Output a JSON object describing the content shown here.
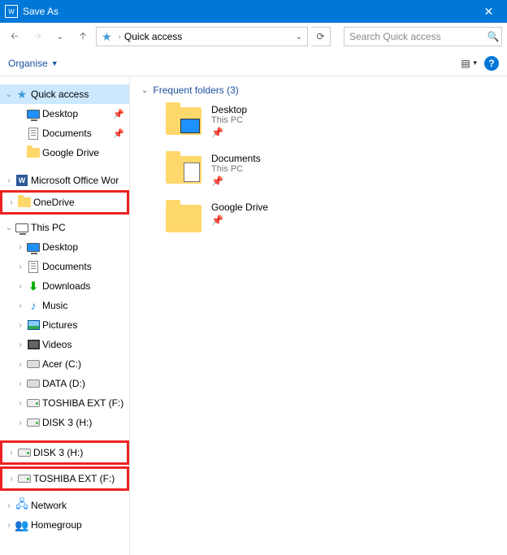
{
  "titlebar": {
    "title": "Save As",
    "appicon_letter": "W"
  },
  "nav": {
    "path_label": "Quick access",
    "search_placeholder": "Search Quick access"
  },
  "toolbar": {
    "organise_label": "Organise",
    "help_symbol": "?"
  },
  "sidebar": {
    "quick_access": {
      "label": "Quick access",
      "items": [
        {
          "label": "Desktop",
          "icon": "desktop",
          "pinned": true
        },
        {
          "label": "Documents",
          "icon": "document",
          "pinned": true
        },
        {
          "label": "Google Drive",
          "icon": "folder",
          "pinned": false
        }
      ]
    },
    "ms_office": {
      "label": "Microsoft Office Wor"
    },
    "onedrive": {
      "label": "OneDrive"
    },
    "this_pc": {
      "label": "This PC",
      "items": [
        {
          "label": "Desktop",
          "icon": "desktop"
        },
        {
          "label": "Documents",
          "icon": "document"
        },
        {
          "label": "Downloads",
          "icon": "download"
        },
        {
          "label": "Music",
          "icon": "music"
        },
        {
          "label": "Pictures",
          "icon": "picture"
        },
        {
          "label": "Videos",
          "icon": "video"
        },
        {
          "label": "Acer (C:)",
          "icon": "disk"
        },
        {
          "label": "DATA (D:)",
          "icon": "disk"
        },
        {
          "label": "TOSHIBA EXT (F:)",
          "icon": "drive"
        },
        {
          "label": "DISK 3 (H:)",
          "icon": "drive"
        }
      ]
    },
    "disk3_top": {
      "label": "DISK 3 (H:)"
    },
    "toshiba_top": {
      "label": "TOSHIBA EXT (F:)"
    },
    "network": {
      "label": "Network"
    },
    "homegroup": {
      "label": "Homegroup"
    }
  },
  "main": {
    "section_title": "Frequent folders (3)",
    "folders": [
      {
        "name": "Desktop",
        "sub": "This PC",
        "pinned": true,
        "kind": "desk"
      },
      {
        "name": "Documents",
        "sub": "This PC",
        "pinned": true,
        "kind": "doc"
      },
      {
        "name": "Google Drive",
        "sub": "",
        "pinned": true,
        "kind": "plain"
      }
    ]
  }
}
